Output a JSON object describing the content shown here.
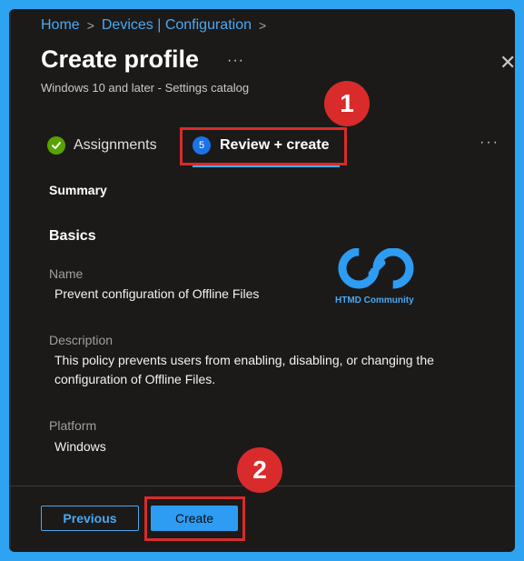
{
  "breadcrumb": {
    "items": [
      "Home",
      "Devices | Configuration"
    ],
    "separator": ">"
  },
  "header": {
    "title": "Create profile",
    "more": "···",
    "subtitle": "Windows 10 and later - Settings catalog",
    "close": "✕"
  },
  "tabs": {
    "assignments_label": "Assignments",
    "review_step": "5",
    "review_label": "Review + create",
    "more": "···"
  },
  "summary": {
    "heading": "Summary",
    "basics_heading": "Basics",
    "name_label": "Name",
    "name_value": "Prevent configuration of Offline Files",
    "description_label": "Description",
    "description_value": "This policy prevents users from enabling, disabling, or changing the configuration of Offline Files.",
    "platform_label": "Platform",
    "platform_value": "Windows"
  },
  "watermark": {
    "text": "HTMD Community"
  },
  "footer": {
    "previous_label": "Previous",
    "create_label": "Create"
  },
  "annotations": {
    "badge_1": "1",
    "badge_2": "2"
  },
  "colors": {
    "outer_background": "#2ea3f2",
    "panel_background": "#1b1a19",
    "accent": "#4aa8f2",
    "highlight_red": "#d92b2b",
    "success_green": "#57a300"
  }
}
